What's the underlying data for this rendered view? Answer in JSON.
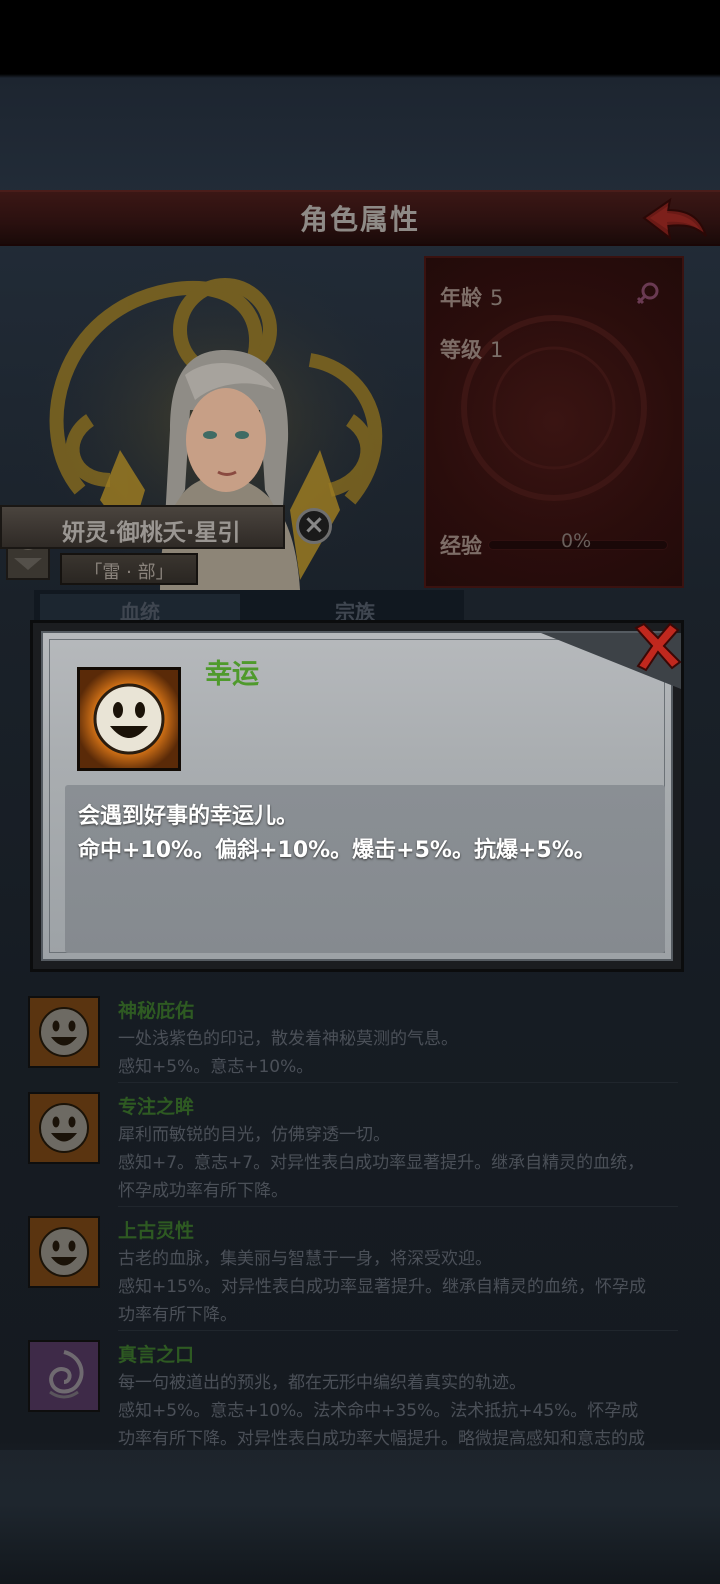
{
  "header": {
    "title": "角色属性"
  },
  "character": {
    "name": "妍灵·御桃夭·星引",
    "clan": "「雷 · 部」",
    "age_label": "年龄",
    "age_value": "5",
    "level_label": "等级",
    "level_value": "1",
    "exp_label": "经验",
    "exp_value": "0%",
    "exp_progress": 0
  },
  "tabs": [
    {
      "label": "血统"
    },
    {
      "label": "宗族"
    }
  ],
  "modal": {
    "title": "幸运",
    "icon": "smiley-face-icon",
    "lines": [
      "会遇到好事的幸运儿。",
      "命中+10%。偏斜+10%。爆击+5%。抗爆+5%。"
    ]
  },
  "traits": [
    {
      "name": "神秘庇佑",
      "icon": "smiley-face-icon",
      "lines": [
        "一处浅紫色的印记，散发着神秘莫测的气息。",
        "感知+5%。意志+10%。"
      ]
    },
    {
      "name": "专注之眸",
      "icon": "smiley-face-icon",
      "lines": [
        "犀利而敏锐的目光，仿佛穿透一切。",
        "感知+7。意志+7。对异性表白成功率显著提升。继承自精灵的血统，",
        "怀孕成功率有所下降。"
      ]
    },
    {
      "name": "上古灵性",
      "icon": "smiley-face-icon",
      "lines": [
        "古老的血脉，集美丽与智慧于一身，将深受欢迎。",
        "感知+15%。对异性表白成功率显著提升。继承自精灵的血统，怀孕成",
        "功率有所下降。"
      ]
    },
    {
      "name": "真言之口",
      "icon": "spiral-mouth-icon",
      "lines": [
        "每一句被道出的预兆，都在无形中编织着真实的轨迹。",
        "感知+5%。意志+10%。法术命中+35%。法术抵抗+45%。怀孕成",
        "功率有所下降。对异性表白成功率大幅提升。略微提高感知和意志的成"
      ]
    }
  ],
  "colors": {
    "title_bar": "#2a100f",
    "modal_title": "#4f9a2c",
    "trait_name": "#2e5a22",
    "close_red": "#c0281e",
    "icon_orange": "#e07a18"
  }
}
